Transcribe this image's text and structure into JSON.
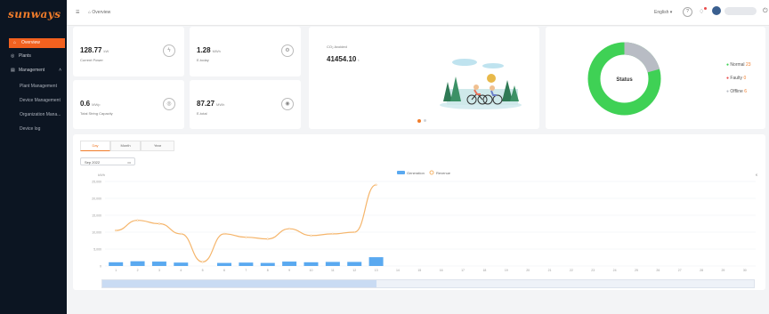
{
  "logo": "sunways",
  "sidebar": {
    "items": [
      {
        "label": "Overview",
        "icon": "home-icon"
      },
      {
        "label": "Plants",
        "icon": "plant-icon"
      },
      {
        "label": "Management",
        "icon": "management-icon"
      }
    ],
    "subitems": [
      "Plant Management",
      "Device Management",
      "Organization Mana...",
      "Device log"
    ]
  },
  "topbar": {
    "breadcrumb": "Overview",
    "language": "English"
  },
  "kpis": [
    {
      "value": "128.77",
      "unit": "kW",
      "label": "Current Power"
    },
    {
      "value": "1.28",
      "unit": "MWh",
      "label": "E-today"
    },
    {
      "value": "0.6",
      "unit": "MWp",
      "label": "Total String Capacity"
    },
    {
      "value": "87.27",
      "unit": "MWh",
      "label": "E-total"
    }
  ],
  "co2": {
    "label": "CO₂ Avoided",
    "value": "41454.10",
    "unit": "t"
  },
  "status": {
    "title": "Status",
    "legend": [
      {
        "label": "Normal",
        "count": "23",
        "color": "#3fd155"
      },
      {
        "label": "Faulty",
        "count": "0",
        "color": "#e94b4b"
      },
      {
        "label": "Offline",
        "count": "6",
        "color": "#b8bcc4"
      }
    ]
  },
  "tabs": [
    "Day",
    "Month",
    "Year"
  ],
  "date_picker": "Sep 2022",
  "chart_data": {
    "type": "bar",
    "y_left_label": "kWh",
    "y_right_label": "€",
    "y_ticks": [
      "25,000",
      "20,000",
      "15,000",
      "10,000",
      "5,000",
      "0"
    ],
    "ylim": [
      0,
      25000
    ],
    "categories": [
      "1",
      "2",
      "3",
      "4",
      "5",
      "6",
      "7",
      "8",
      "9",
      "10",
      "11",
      "12",
      "13",
      "14",
      "15",
      "16",
      "17",
      "18",
      "19",
      "20",
      "21",
      "22",
      "23",
      "24",
      "25",
      "26",
      "27",
      "28",
      "29",
      "30"
    ],
    "series": [
      {
        "name": "Generation",
        "type": "bar",
        "color": "#5aa9f0",
        "values": [
          1100,
          1400,
          1300,
          1000,
          0,
          900,
          1000,
          900,
          1300,
          1100,
          1200,
          1200,
          2600,
          0,
          0,
          0,
          0,
          0,
          0,
          0,
          0,
          0,
          0,
          0,
          0,
          0,
          0,
          0,
          0,
          0
        ]
      },
      {
        "name": "Revenue",
        "type": "line",
        "color": "#f5b56b",
        "values": [
          10500,
          13500,
          12500,
          9500,
          1200,
          9500,
          8500,
          8000,
          11000,
          9000,
          9500,
          10000,
          24000
        ]
      }
    ]
  },
  "colors": {
    "accent": "#f2611f",
    "sidebar": "#0c1522",
    "normal": "#3fd155",
    "offline": "#b8bcc4"
  }
}
